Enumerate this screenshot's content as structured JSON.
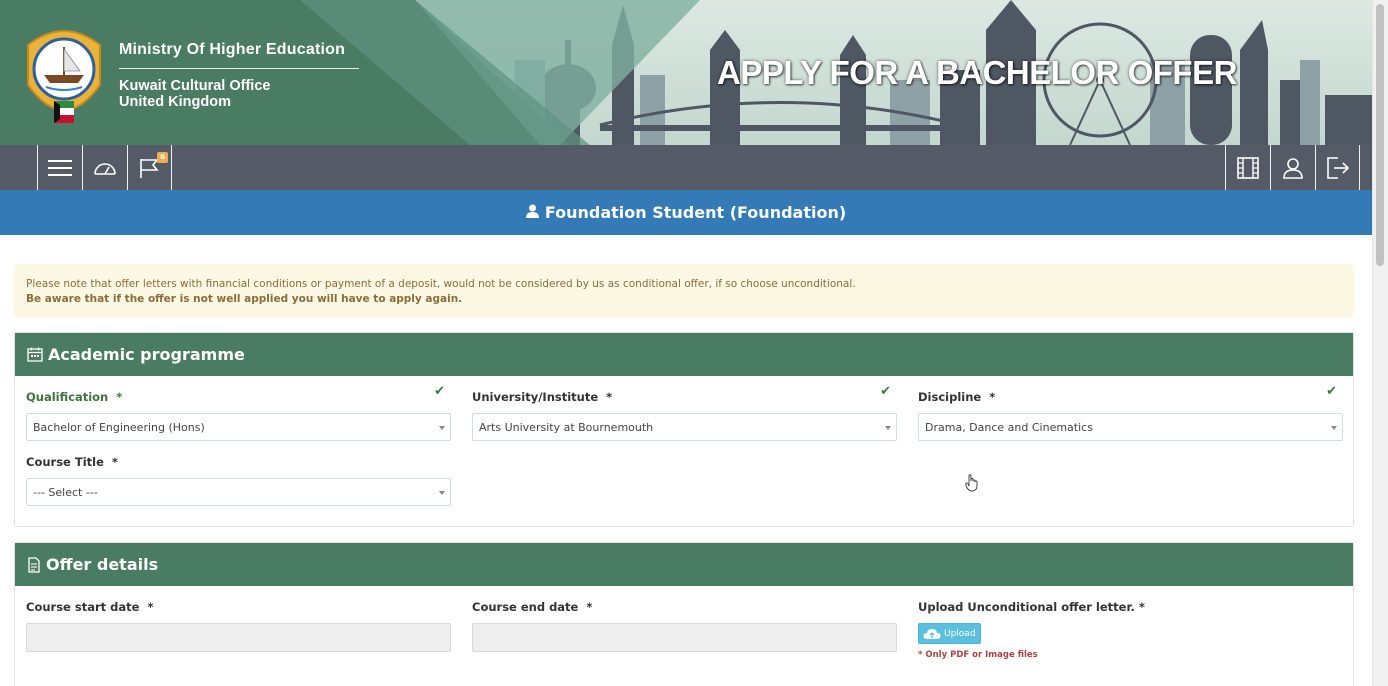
{
  "banner": {
    "title": "Ministry Of Higher Education",
    "subtitle_line1": "Kuwait Cultural Office",
    "subtitle_line2": "United Kingdom",
    "heading": "APPLY FOR A BACHELOR OFFER"
  },
  "toolbar": {
    "left": [
      {
        "icon": "menu-icon"
      },
      {
        "icon": "dashboard-icon"
      },
      {
        "icon": "flag-icon",
        "badge": "6"
      }
    ],
    "right": [
      {
        "icon": "film-icon"
      },
      {
        "icon": "user-icon"
      },
      {
        "icon": "logout-icon"
      }
    ]
  },
  "student": {
    "label": "Foundation Student (Foundation)"
  },
  "notice": {
    "line1": "Please note that offer letters with financial conditions or payment of a deposit, would not be considered by us as conditional offer, if so choose unconditional.",
    "line2": "Be aware that if the offer is not well applied you will have to apply again."
  },
  "academic": {
    "title": "Academic programme",
    "qualification": {
      "label": "Qualification",
      "required": "*",
      "value": "Bachelor of Engineering (Hons)"
    },
    "university": {
      "label": "University/Institute",
      "required": "*",
      "value": "Arts University at Bournemouth"
    },
    "discipline": {
      "label": "Discipline",
      "required": "*",
      "value": "Drama, Dance and Cinematics"
    },
    "course_title": {
      "label": "Course Title",
      "required": "*",
      "value": "--- Select ---"
    }
  },
  "offer": {
    "title": "Offer details",
    "start_date": {
      "label": "Course start date",
      "required": "*"
    },
    "end_date": {
      "label": "Course end date",
      "required": "*"
    },
    "upload": {
      "label": "Upload Unconditional offer letter. *",
      "button": "Upload",
      "note": "* Only PDF or Image files"
    }
  },
  "colors": {
    "banner_green": "#4a7b63",
    "toolbar": "#555b66",
    "student_bar": "#337ab7",
    "notice_bg": "#fcf8e3",
    "notice_text": "#8a6d3b",
    "upload_button": "#5bc0de",
    "error_text": "#a94442"
  }
}
